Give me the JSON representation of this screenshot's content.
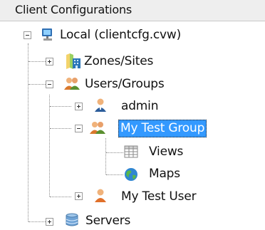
{
  "panel": {
    "title": "Client Configurations"
  },
  "tree": {
    "root": {
      "label": "Local (clientcfg.cvw)",
      "expanded": true,
      "icon": "computer-icon"
    },
    "zones_sites": {
      "label": "Zones/Sites",
      "expanded": false,
      "icon": "zones-sites-icon"
    },
    "users_groups": {
      "label": "Users/Groups",
      "expanded": true,
      "icon": "users-groups-icon"
    },
    "admin": {
      "label": "admin",
      "expanded": false,
      "icon": "user-icon"
    },
    "my_test_group": {
      "label": "My Test Group",
      "expanded": true,
      "selected": true,
      "icon": "group-icon"
    },
    "views": {
      "label": "Views",
      "icon": "views-grid-icon"
    },
    "maps": {
      "label": "Maps",
      "icon": "globe-icon"
    },
    "my_test_user": {
      "label": "My Test User",
      "expanded": false,
      "icon": "user-icon"
    },
    "servers": {
      "label": "Servers",
      "expanded": false,
      "icon": "database-icon"
    }
  },
  "colors": {
    "selection": "#3399ff",
    "header_bg": "#eeeeee"
  }
}
